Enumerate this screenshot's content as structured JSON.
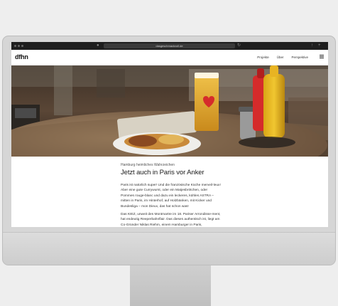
{
  "browser": {
    "url": "dasgeschmackvoll.de"
  },
  "site": {
    "logo": "dfhn",
    "nav": [
      "Projekte",
      "Über",
      "Perspektive"
    ]
  },
  "hero": {
    "icon": "beer-glass-heart-logo"
  },
  "article": {
    "kicker": "Hamburg heimliches Wahrzeichen",
    "headline": "Jetzt auch in Paris vor Anker",
    "paragraphs": [
      "Paris ist natürlich super! Und die französische Küche merveil-leux! Aber eine gute Currywurst, oder ein Matjesbrötchen, oder Pommes rouge-blanc und dazu ein leckeres, kühles ASTRA – mitten in Paris, im Hinterhof, auf Holzbänken, mit Kicker und Bundesliga – mon Dieux, das hat schon was!",
      "Das KIEZ, unweit des Montmartre im 18. Pariser Arrondisse-ment, hat endeutig Reeperbahnflair. Das dieses authentisch ist, liegt am Co-Gründer Niklas Riehm, einem Hamburger in Paris,"
    ]
  }
}
